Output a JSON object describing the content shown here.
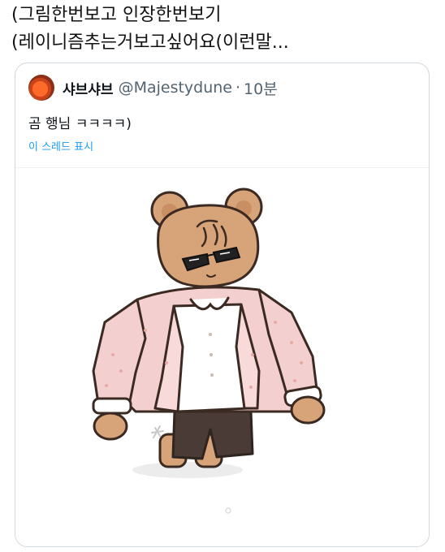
{
  "post": {
    "line1": "(그림한번보고 인장한번보기",
    "line2": "(레이니즘추는거보고싶어요(이런말..."
  },
  "quote": {
    "display_name": "샤브샤브",
    "handle": "@Majestydune",
    "separator": "·",
    "time": "10분",
    "text": "곰 행님 ㅋㅋㅋㅋ)",
    "thread_link": "이 스레드 표시"
  },
  "colors": {
    "bear": "#d7a378",
    "jacket": "#f4cfcf",
    "link": "#1d9bf0",
    "border": "#cfd9de"
  },
  "media": {
    "alt_icon": "bear-in-pink-suit-illustration"
  }
}
